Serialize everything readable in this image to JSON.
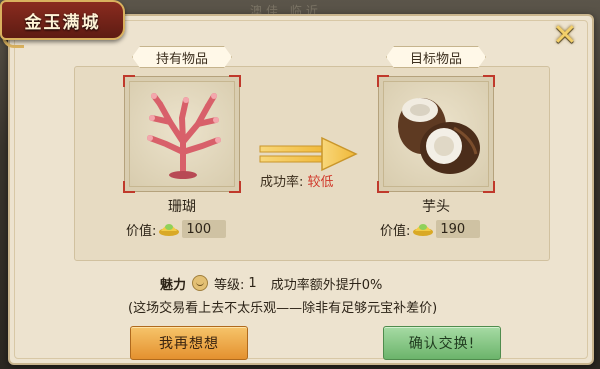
{
  "background": {
    "top_text": "澳佳 临近"
  },
  "dialog": {
    "title": "金玉满城",
    "close_icon": "close-x-icon"
  },
  "held": {
    "label": "持有物品",
    "item_name": "珊瑚",
    "value_label": "价值:",
    "value": "100",
    "icon": "coral-icon"
  },
  "target": {
    "label": "目标物品",
    "item_name": "芋头",
    "value_label": "价值:",
    "value": "190",
    "icon": "taro-icon"
  },
  "success": {
    "label": "成功率:",
    "value": "较低"
  },
  "charm": {
    "label": "魅力",
    "level_label": "等级:",
    "level": "1",
    "bonus_text": "成功率额外提升0%"
  },
  "hint": "(这场交易看上去不太乐观——除非有足够元宝补差价)",
  "buttons": {
    "think": "我再想想",
    "confirm": "确认交换!"
  },
  "colors": {
    "title_bg": "#8a2b1f",
    "low_text": "#d0382a",
    "think_btn": "#e4912f",
    "confirm_btn": "#6cb46b"
  }
}
